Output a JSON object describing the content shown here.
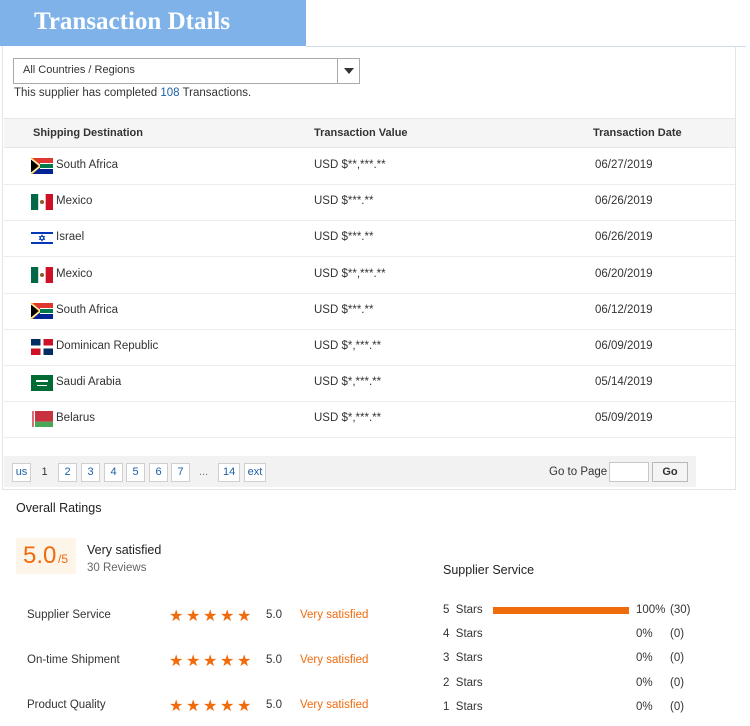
{
  "header": {
    "title": "Transaction Dtails"
  },
  "filter": {
    "selected": "All Countries / Regions"
  },
  "summary": {
    "prefix": "This supplier has completed",
    "count": "108",
    "suffix": "Transactions."
  },
  "table": {
    "columns": [
      "Shipping Destination",
      "Transaction Value",
      "Transaction Date"
    ],
    "rows": [
      {
        "country": "South Africa",
        "flag": "za-flag-icon",
        "value": "USD $**,***.**",
        "date": "06/27/2019"
      },
      {
        "country": "Mexico",
        "flag": "mx-flag-icon",
        "value": "USD $***.**",
        "date": "06/26/2019"
      },
      {
        "country": "Israel",
        "flag": "il-flag-icon",
        "value": "USD $***.**",
        "date": "06/26/2019"
      },
      {
        "country": "Mexico",
        "flag": "mx-flag-icon",
        "value": "USD $**,***.**",
        "date": "06/20/2019"
      },
      {
        "country": "South Africa",
        "flag": "za-flag-icon",
        "value": "USD $***.**",
        "date": "06/12/2019"
      },
      {
        "country": "Dominican Republic",
        "flag": "do-flag-icon",
        "value": "USD $*,***.**",
        "date": "06/09/2019"
      },
      {
        "country": "Saudi Arabia",
        "flag": "sa-flag-icon",
        "value": "USD $*,***.**",
        "date": "05/14/2019"
      },
      {
        "country": "Belarus",
        "flag": "by-flag-icon",
        "value": "USD $*,***.**",
        "date": "05/09/2019"
      }
    ]
  },
  "pagination": {
    "prev": "us",
    "pages": [
      "1",
      "2",
      "3",
      "4",
      "5",
      "6",
      "7",
      "...",
      "14"
    ],
    "current": "1",
    "next": "ext",
    "goto_label": "Go to Page",
    "goto_button": "Go"
  },
  "ratings": {
    "title": "Overall Ratings",
    "score": "5.0",
    "score_of": "/5",
    "label": "Very satisfied",
    "reviews": "30 Reviews",
    "categories": [
      {
        "label": "Supplier Service",
        "stars": 5,
        "score": "5.0",
        "text": "Very satisfied"
      },
      {
        "label": "On-time Shipment",
        "stars": 5,
        "score": "5.0",
        "text": "Very satisfied"
      },
      {
        "label": "Product Quality",
        "stars": 5,
        "score": "5.0",
        "text": "Very satisfied"
      }
    ],
    "distribution_title": "Supplier Service",
    "distribution": [
      {
        "label": "5  Stars",
        "percent": "100%",
        "count": "(30)",
        "fraction": 1.0
      },
      {
        "label": "4  Stars",
        "percent": "0%",
        "count": "(0)",
        "fraction": 0
      },
      {
        "label": "3  Stars",
        "percent": "0%",
        "count": "(0)",
        "fraction": 0
      },
      {
        "label": "2  Stars",
        "percent": "0%",
        "count": "(0)",
        "fraction": 0
      },
      {
        "label": "1  Stars",
        "percent": "0%",
        "count": "(0)",
        "fraction": 0
      }
    ]
  },
  "colors": {
    "accent": "#f06b0c",
    "link": "#1f5fa8",
    "banner": "#7fb2e8"
  }
}
